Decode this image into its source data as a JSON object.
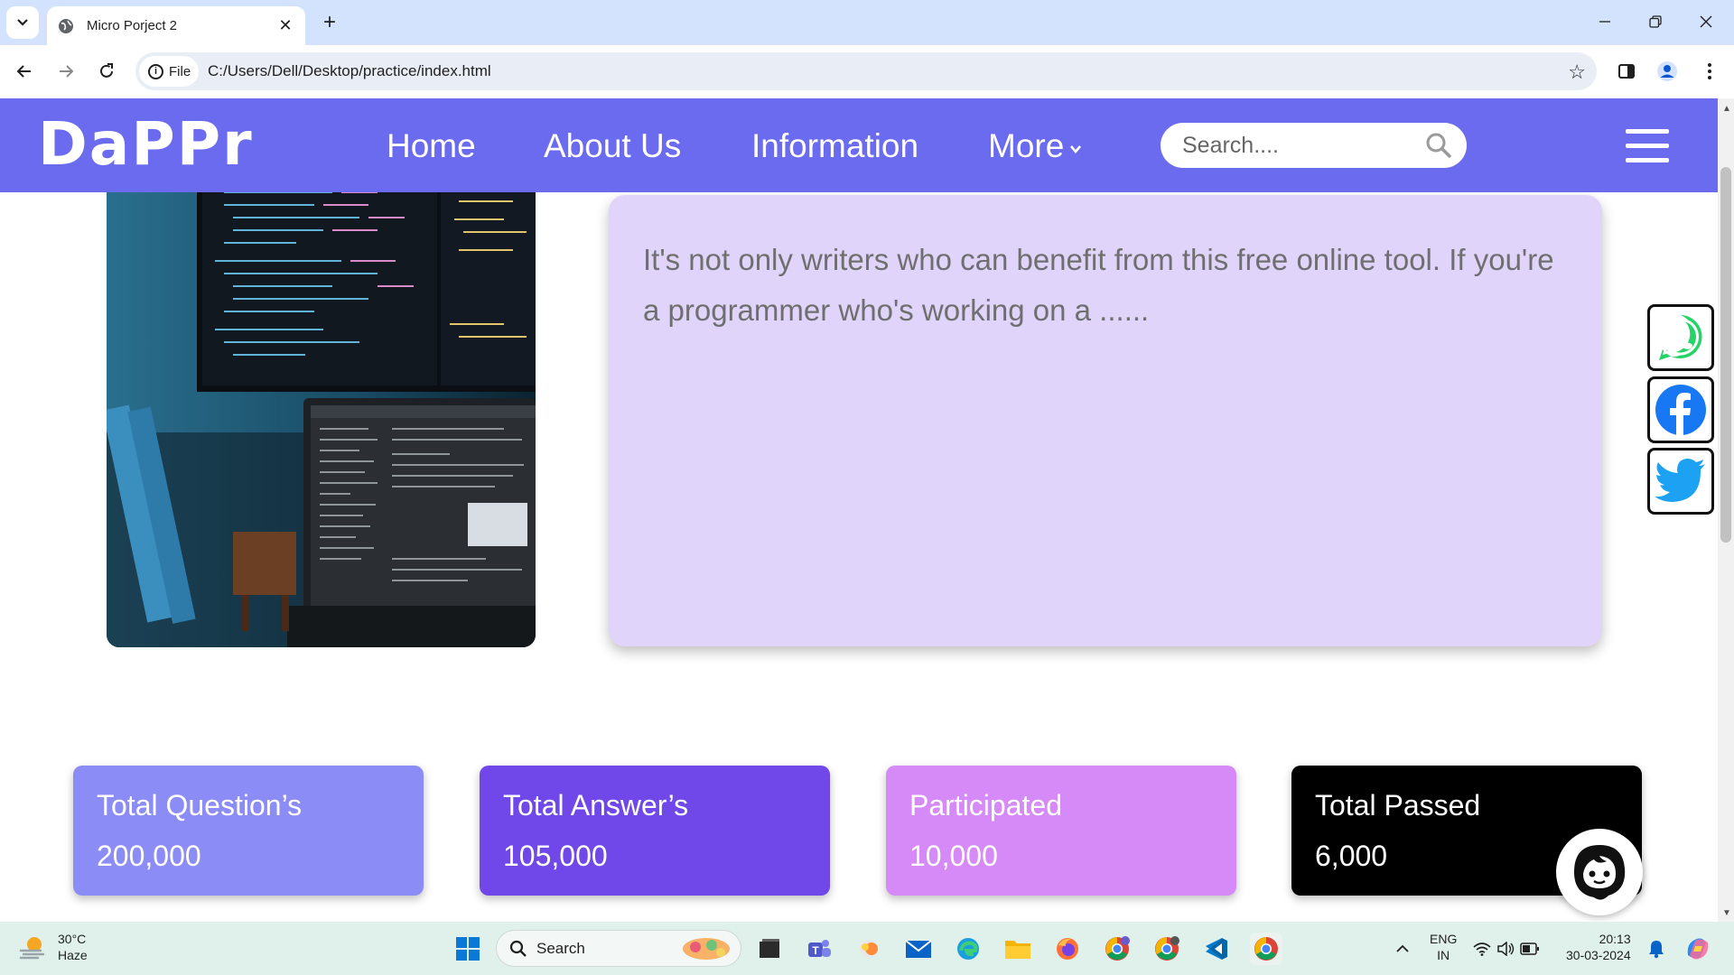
{
  "browser": {
    "tab_title": "Micro Porject 2",
    "file_chip": "File",
    "url": "C:/Users/Dell/Desktop/practice/index.html"
  },
  "site": {
    "logo": "DaPPr",
    "nav": {
      "home": "Home",
      "about": "About Us",
      "information": "Information",
      "more": "More"
    },
    "search_placeholder": "Search....",
    "intro_text": "It's not only writers who can benefit from this free online tool. If you're a programmer who's working on a ......",
    "stats": [
      {
        "label": "Total Question’s",
        "value": "200,000",
        "color": "#8c8cf7"
      },
      {
        "label": "Total Answer’s",
        "value": "105,000",
        "color": "#7048ea"
      },
      {
        "label": "Participated",
        "value": "10,000",
        "color": "#d68af7"
      },
      {
        "label": "Total Passed",
        "value": "6,000",
        "color": "#000000"
      }
    ],
    "social": [
      "whatsapp-icon",
      "facebook-icon",
      "twitter-icon"
    ],
    "accent": "#6b6bf0",
    "card_bg": "#e0d4fb"
  },
  "taskbar": {
    "weather_temp": "30°C",
    "weather_cond": "Haze",
    "search_label": "Search",
    "lang_top": "ENG",
    "lang_bottom": "IN",
    "time": "20:13",
    "date": "30-03-2024"
  }
}
